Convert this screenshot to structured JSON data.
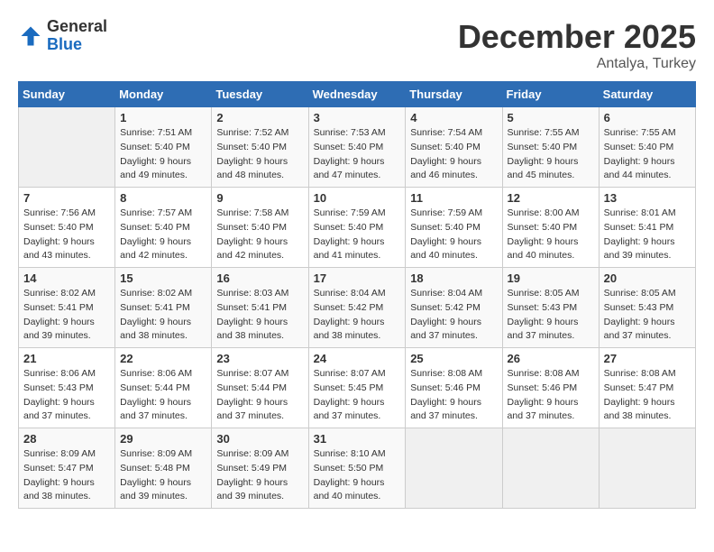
{
  "header": {
    "logo_general": "General",
    "logo_blue": "Blue",
    "month_title": "December 2025",
    "subtitle": "Antalya, Turkey"
  },
  "days_of_week": [
    "Sunday",
    "Monday",
    "Tuesday",
    "Wednesday",
    "Thursday",
    "Friday",
    "Saturday"
  ],
  "weeks": [
    [
      {
        "day": "",
        "sunrise": "",
        "sunset": "",
        "daylight": ""
      },
      {
        "day": "1",
        "sunrise": "7:51 AM",
        "sunset": "5:40 PM",
        "daylight": "9 hours and 49 minutes."
      },
      {
        "day": "2",
        "sunrise": "7:52 AM",
        "sunset": "5:40 PM",
        "daylight": "9 hours and 48 minutes."
      },
      {
        "day": "3",
        "sunrise": "7:53 AM",
        "sunset": "5:40 PM",
        "daylight": "9 hours and 47 minutes."
      },
      {
        "day": "4",
        "sunrise": "7:54 AM",
        "sunset": "5:40 PM",
        "daylight": "9 hours and 46 minutes."
      },
      {
        "day": "5",
        "sunrise": "7:55 AM",
        "sunset": "5:40 PM",
        "daylight": "9 hours and 45 minutes."
      },
      {
        "day": "6",
        "sunrise": "7:55 AM",
        "sunset": "5:40 PM",
        "daylight": "9 hours and 44 minutes."
      }
    ],
    [
      {
        "day": "7",
        "sunrise": "7:56 AM",
        "sunset": "5:40 PM",
        "daylight": "9 hours and 43 minutes."
      },
      {
        "day": "8",
        "sunrise": "7:57 AM",
        "sunset": "5:40 PM",
        "daylight": "9 hours and 42 minutes."
      },
      {
        "day": "9",
        "sunrise": "7:58 AM",
        "sunset": "5:40 PM",
        "daylight": "9 hours and 42 minutes."
      },
      {
        "day": "10",
        "sunrise": "7:59 AM",
        "sunset": "5:40 PM",
        "daylight": "9 hours and 41 minutes."
      },
      {
        "day": "11",
        "sunrise": "7:59 AM",
        "sunset": "5:40 PM",
        "daylight": "9 hours and 40 minutes."
      },
      {
        "day": "12",
        "sunrise": "8:00 AM",
        "sunset": "5:40 PM",
        "daylight": "9 hours and 40 minutes."
      },
      {
        "day": "13",
        "sunrise": "8:01 AM",
        "sunset": "5:41 PM",
        "daylight": "9 hours and 39 minutes."
      }
    ],
    [
      {
        "day": "14",
        "sunrise": "8:02 AM",
        "sunset": "5:41 PM",
        "daylight": "9 hours and 39 minutes."
      },
      {
        "day": "15",
        "sunrise": "8:02 AM",
        "sunset": "5:41 PM",
        "daylight": "9 hours and 38 minutes."
      },
      {
        "day": "16",
        "sunrise": "8:03 AM",
        "sunset": "5:41 PM",
        "daylight": "9 hours and 38 minutes."
      },
      {
        "day": "17",
        "sunrise": "8:04 AM",
        "sunset": "5:42 PM",
        "daylight": "9 hours and 38 minutes."
      },
      {
        "day": "18",
        "sunrise": "8:04 AM",
        "sunset": "5:42 PM",
        "daylight": "9 hours and 37 minutes."
      },
      {
        "day": "19",
        "sunrise": "8:05 AM",
        "sunset": "5:43 PM",
        "daylight": "9 hours and 37 minutes."
      },
      {
        "day": "20",
        "sunrise": "8:05 AM",
        "sunset": "5:43 PM",
        "daylight": "9 hours and 37 minutes."
      }
    ],
    [
      {
        "day": "21",
        "sunrise": "8:06 AM",
        "sunset": "5:43 PM",
        "daylight": "9 hours and 37 minutes."
      },
      {
        "day": "22",
        "sunrise": "8:06 AM",
        "sunset": "5:44 PM",
        "daylight": "9 hours and 37 minutes."
      },
      {
        "day": "23",
        "sunrise": "8:07 AM",
        "sunset": "5:44 PM",
        "daylight": "9 hours and 37 minutes."
      },
      {
        "day": "24",
        "sunrise": "8:07 AM",
        "sunset": "5:45 PM",
        "daylight": "9 hours and 37 minutes."
      },
      {
        "day": "25",
        "sunrise": "8:08 AM",
        "sunset": "5:46 PM",
        "daylight": "9 hours and 37 minutes."
      },
      {
        "day": "26",
        "sunrise": "8:08 AM",
        "sunset": "5:46 PM",
        "daylight": "9 hours and 37 minutes."
      },
      {
        "day": "27",
        "sunrise": "8:08 AM",
        "sunset": "5:47 PM",
        "daylight": "9 hours and 38 minutes."
      }
    ],
    [
      {
        "day": "28",
        "sunrise": "8:09 AM",
        "sunset": "5:47 PM",
        "daylight": "9 hours and 38 minutes."
      },
      {
        "day": "29",
        "sunrise": "8:09 AM",
        "sunset": "5:48 PM",
        "daylight": "9 hours and 39 minutes."
      },
      {
        "day": "30",
        "sunrise": "8:09 AM",
        "sunset": "5:49 PM",
        "daylight": "9 hours and 39 minutes."
      },
      {
        "day": "31",
        "sunrise": "8:10 AM",
        "sunset": "5:50 PM",
        "daylight": "9 hours and 40 minutes."
      },
      {
        "day": "",
        "sunrise": "",
        "sunset": "",
        "daylight": ""
      },
      {
        "day": "",
        "sunrise": "",
        "sunset": "",
        "daylight": ""
      },
      {
        "day": "",
        "sunrise": "",
        "sunset": "",
        "daylight": ""
      }
    ]
  ]
}
